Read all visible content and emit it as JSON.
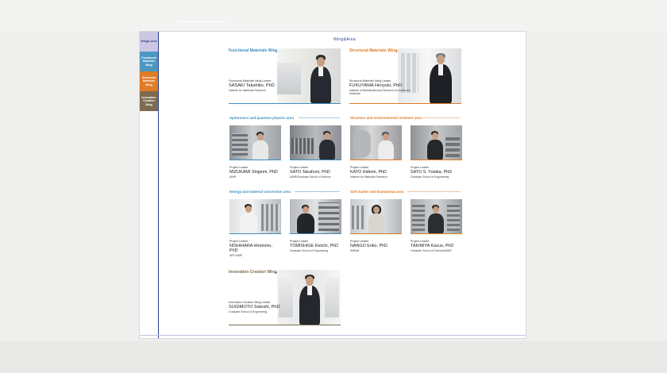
{
  "page_title": "Wing&Area",
  "nav_tabs": [
    {
      "label": "Wing& Area"
    },
    {
      "label": "Functional Materials Wing"
    },
    {
      "label": "Structural Materials Wing"
    },
    {
      "label": "Innovation Creation Wing"
    }
  ],
  "wings": {
    "functional": {
      "title": "Functional Materials Wing",
      "role": "Functional Materials Wing Leader",
      "name": "SASAKI Takahiko, PhD",
      "institute": "Institute for Materials Research"
    },
    "structural": {
      "title": "Structural Materials Wing",
      "role": "Structural Materials Wing Leader",
      "name": "FUKUYAMA Hiroyuki, PhD",
      "institute": "Institute of Multidisciplinary Research for Advanced Materials"
    },
    "innovation": {
      "title": "Innovation Creation Wing",
      "role": "Innovation Creation Wing Leader",
      "name": "SUGIMOTO Satoshi, PhD",
      "institute": "Graduate School of Engineering"
    }
  },
  "areas": {
    "spintronics": {
      "title": "Spintronics and quantum physics area",
      "members": [
        {
          "role": "Project Leader",
          "name": "MIZUKAMI Shigemi, PhD",
          "institute": "AIMR"
        },
        {
          "role": "Project Leader",
          "name": "SATO Takafumi, PhD",
          "institute": "AIMR/Graduate School of Science"
        }
      ]
    },
    "structure": {
      "title": "Structure and environmental resistant area",
      "members": [
        {
          "role": "Project Leader",
          "name": "KATO Hidemi, PhD",
          "institute": "Institute for Materials Research"
        },
        {
          "role": "Project Leader",
          "name": "SATO S. Yutaka, PhD",
          "institute": "Graduate School of Engineering"
        }
      ]
    },
    "energy": {
      "title": "Energy and material conversion area",
      "members": [
        {
          "role": "Project Leader",
          "name": "NISHIHARA Hirotomo, PhD",
          "institute": "WPI-AIMR"
        },
        {
          "role": "Project Leader",
          "name": "TOMISHIGE Keiichi, PhD",
          "institute": "Graduate School of Engineering"
        }
      ]
    },
    "softmatter": {
      "title": "Soft matter and biomaterial area",
      "members": [
        {
          "role": "Project Leader",
          "name": "NANGO Eriko, PhD",
          "institute": "IMRAM"
        },
        {
          "role": "Project Leader",
          "name": "TAKIMIYA Kazuo, PhD",
          "institute": "Graduate School of Science/AIMR"
        }
      ]
    }
  },
  "colors": {
    "navy": "#2f3f8a",
    "functional": "#3d8fc0",
    "structural": "#e07b26",
    "innovation": "#7d6b4f",
    "nav_first": "#ccc7e3"
  },
  "icons": [
    "portrait-photo"
  ]
}
